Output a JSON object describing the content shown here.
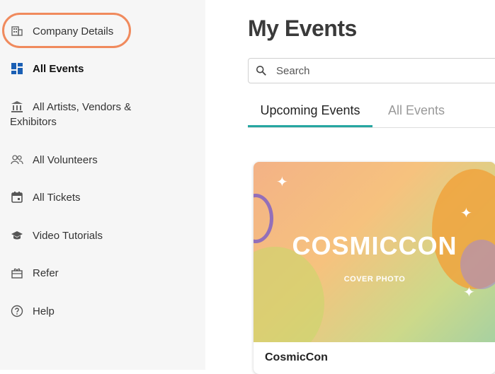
{
  "sidebar": {
    "items": [
      {
        "label": "Company Details",
        "icon": "building-icon"
      },
      {
        "label": "All Events",
        "icon": "dashboard-icon"
      },
      {
        "label_line1": "All Artists, Vendors &",
        "label_line2": "Exhibitors",
        "icon": "bank-icon"
      },
      {
        "label": "All Volunteers",
        "icon": "people-icon"
      },
      {
        "label": "All Tickets",
        "icon": "calendar-icon"
      },
      {
        "label": "Video Tutorials",
        "icon": "graduation-cap-icon"
      },
      {
        "label": "Refer",
        "icon": "gift-icon"
      },
      {
        "label": "Help",
        "icon": "help-circle-icon"
      }
    ]
  },
  "main": {
    "title": "My Events",
    "search": {
      "placeholder": "Search",
      "value": ""
    },
    "tabs": [
      {
        "label": "Upcoming Events",
        "active": true
      },
      {
        "label": "All Events",
        "active": false
      }
    ],
    "events": [
      {
        "name": "CosmicCon",
        "cover_title": "COSMICCON",
        "cover_subtitle": "COVER PHOTO"
      }
    ]
  },
  "colors": {
    "accent": "#26a6a1",
    "highlight": "#f08a5d",
    "active_icon": "#1a5fb4"
  }
}
